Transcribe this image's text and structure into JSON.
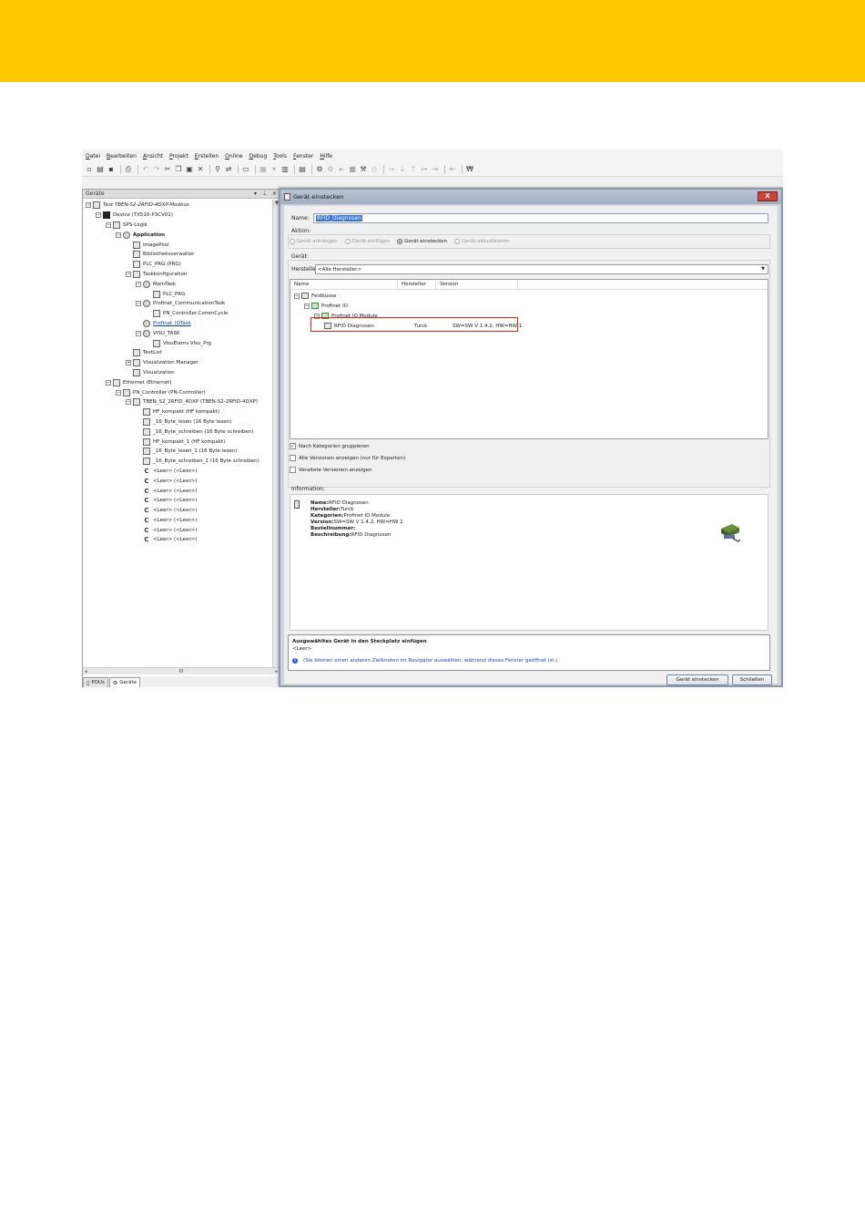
{
  "menu": [
    "Datei",
    "Bearbeiten",
    "Ansicht",
    "Projekt",
    "Erstellen",
    "Online",
    "Debug",
    "Tools",
    "Fenster",
    "Hilfe"
  ],
  "device_pane": {
    "title": "Geräte",
    "pin": "▾",
    "pin2": "⊥",
    "close": "✕",
    "tree": [
      {
        "label": "Test TBEN-S2-2RFID-4DXP-Modbus",
        "depth": 0,
        "expander": "−",
        "icon": "doc-icon",
        "style": "italic"
      },
      {
        "label": "Device (TX510-P3CV01)",
        "depth": 1,
        "expander": "−",
        "icon": "device-icon",
        "style": "normal"
      },
      {
        "label": "SPS-Logik",
        "depth": 2,
        "expander": "−",
        "icon": "plc-icon",
        "style": "normal"
      },
      {
        "label": "Application",
        "depth": 3,
        "expander": "−",
        "icon": "gear-icon",
        "style": "bold"
      },
      {
        "label": "ImagePool",
        "depth": 4,
        "expander": "",
        "icon": "doc-icon",
        "style": "normal"
      },
      {
        "label": "Bibliotheksverwalter",
        "depth": 4,
        "expander": "",
        "icon": "doc-icon",
        "style": "normal"
      },
      {
        "label": "PLC_PRG (PRG)",
        "depth": 4,
        "expander": "",
        "icon": "doc-icon",
        "style": "normal"
      },
      {
        "label": "Taskkonfiguration",
        "depth": 4,
        "expander": "−",
        "icon": "task-icon",
        "style": "normal"
      },
      {
        "label": "MainTask",
        "depth": 5,
        "expander": "−",
        "icon": "gear-icon",
        "style": "normal"
      },
      {
        "label": "PLC_PRG",
        "depth": 6,
        "expander": "",
        "icon": "doc-icon",
        "style": "normal"
      },
      {
        "label": "Profinet_CommunicationTask",
        "depth": 5,
        "expander": "−",
        "icon": "gear-icon",
        "style": "normal"
      },
      {
        "label": "PN_Controller.CommCycle",
        "depth": 6,
        "expander": "",
        "icon": "doc-icon",
        "style": "normal"
      },
      {
        "label": "Profinet_IOTask",
        "depth": 5,
        "expander": "",
        "icon": "gear-icon",
        "style": "link"
      },
      {
        "label": "VISU_TASK",
        "depth": 5,
        "expander": "−",
        "icon": "gear-icon",
        "style": "normal"
      },
      {
        "label": "VisuElems.Visu_Prg",
        "depth": 6,
        "expander": "",
        "icon": "doc-icon",
        "style": "normal"
      },
      {
        "label": "TextList",
        "depth": 4,
        "expander": "",
        "icon": "doc-icon",
        "style": "normal"
      },
      {
        "label": "Visualization Manager",
        "depth": 4,
        "expander": "+",
        "icon": "visu-icon",
        "style": "normal"
      },
      {
        "label": "Visualization",
        "depth": 4,
        "expander": "",
        "icon": "doc-icon",
        "style": "normal"
      },
      {
        "label": "Ethernet (Ethernet)",
        "depth": 2,
        "expander": "−",
        "icon": "net-icon",
        "style": "normal"
      },
      {
        "label": "PN_Controller (PN-Controller)",
        "depth": 3,
        "expander": "−",
        "icon": "net-icon",
        "style": "normal"
      },
      {
        "label": "TBEN_S2_2RFID_4DXP (TBEN-S2-2RFID-4DXP)",
        "depth": 4,
        "expander": "−",
        "icon": "net-icon",
        "style": "normal"
      },
      {
        "label": "HF_kompakt (HF kompakt)",
        "depth": 5,
        "expander": "",
        "icon": "module-icon",
        "style": "normal"
      },
      {
        "label": "_16_Byte_lesen (16 Byte lesen)",
        "depth": 5,
        "expander": "",
        "icon": "module-icon",
        "style": "normal"
      },
      {
        "label": "_16_Byte_schreiben (16 Byte schreiben)",
        "depth": 5,
        "expander": "",
        "icon": "module-icon",
        "style": "normal"
      },
      {
        "label": "HF_kompakt_1 (HF kompakt)",
        "depth": 5,
        "expander": "",
        "icon": "module-icon",
        "style": "normal"
      },
      {
        "label": "_16_Byte_lesen_1 (16 Byte lesen)",
        "depth": 5,
        "expander": "",
        "icon": "module-icon",
        "style": "normal"
      },
      {
        "label": "_16_Byte_schreiben_1 (16 Byte schreiben)",
        "depth": 5,
        "expander": "",
        "icon": "module-icon",
        "style": "normal"
      },
      {
        "label": "<Leer> (<Leer>)",
        "depth": 5,
        "expander": "",
        "icon": "plug-icon",
        "style": "normal"
      },
      {
        "label": "<Leer> (<Leer>)",
        "depth": 5,
        "expander": "",
        "icon": "plug-icon",
        "style": "normal"
      },
      {
        "label": "<Leer> (<Leer>)",
        "depth": 5,
        "expander": "",
        "icon": "plug-icon",
        "style": "normal"
      },
      {
        "label": "<Leer> (<Leer>)",
        "depth": 5,
        "expander": "",
        "icon": "plug-icon",
        "style": "normal"
      },
      {
        "label": "<Leer> (<Leer>)",
        "depth": 5,
        "expander": "",
        "icon": "plug-icon",
        "style": "normal"
      },
      {
        "label": "<Leer> (<Leer>)",
        "depth": 5,
        "expander": "",
        "icon": "plug-icon",
        "style": "normal"
      },
      {
        "label": "<Leer> (<Leer>)",
        "depth": 5,
        "expander": "",
        "icon": "plug-icon",
        "style": "normal"
      },
      {
        "label": "<Leer> (<Leer>)",
        "depth": 5,
        "expander": "",
        "icon": "plug-icon",
        "style": "normal"
      }
    ],
    "tabs": [
      {
        "label": "POUs",
        "icon": "pou-icon",
        "active": false
      },
      {
        "label": "Geräte",
        "icon": "devices-icon",
        "active": true
      }
    ],
    "hscroll_mid": "III"
  },
  "dialog": {
    "title": "Gerät einstecken",
    "close": "X",
    "name_label": "Name:",
    "name_value": "RFID_Diagnosen",
    "action_label": "Aktion:",
    "actions": [
      {
        "label": "Gerät anhängen",
        "selected": false
      },
      {
        "label": "Gerät einfügen",
        "selected": false
      },
      {
        "label": "Gerät einstecken",
        "selected": true
      },
      {
        "label": "Gerät aktualisieren",
        "selected": false
      }
    ],
    "device_label": "Gerät:",
    "vendor_label": "Hersteller:",
    "vendor_value": "<Alle Hersteller>",
    "columns": [
      "Name",
      "Hersteller",
      "Version"
    ],
    "list": [
      {
        "label": "Feldbusse",
        "vendor": "",
        "version": "",
        "expander": "−"
      },
      {
        "label": "Profinet IO",
        "vendor": "",
        "version": "",
        "expander": "−"
      },
      {
        "label": "Profinet IO Module",
        "vendor": "",
        "version": "",
        "expander": "−"
      },
      {
        "label": "RFID Diagnosen",
        "vendor": "Turck",
        "version": "SW=SW V 1.4.2, HW=HW 1",
        "expander": ""
      }
    ],
    "options": [
      {
        "label": "Nach Kategorien gruppieren",
        "checked": true
      },
      {
        "label": "Alle Versionen anzeigen (nur für Experten)",
        "checked": false
      },
      {
        "label": "Veraltete Versionen anzeigen",
        "checked": false
      }
    ],
    "info_label": "Information:",
    "info": {
      "name_key": "Name:",
      "name_val": "RFID Diagnosen",
      "vendor_key": "Hersteller:",
      "vendor_val": "Turck",
      "cat_key": "Kategorien:",
      "cat_val": "Profinet IO Module",
      "ver_key": "Version:",
      "ver_val": "SW=SW V 1.4.2, HW=HW 1",
      "order_key": "Bestellnummer:",
      "order_val": "",
      "desc_key": "Beschreibung:",
      "desc_val": "RFID Diagnosen"
    },
    "insert_title": "Ausgewähltes Gerät in den Steckplatz einfügen",
    "insert_target": "<Leer>",
    "insert_hint": "(Sie können einen anderen Zielknoten im Navigator auswählen, während dieses Fenster geöffnet ist.)",
    "btn_insert": "Gerät einstecken",
    "btn_close": "Schließen"
  },
  "colors": {
    "accent_band": "#ffc800",
    "highlight_frame": "#e2231a"
  }
}
